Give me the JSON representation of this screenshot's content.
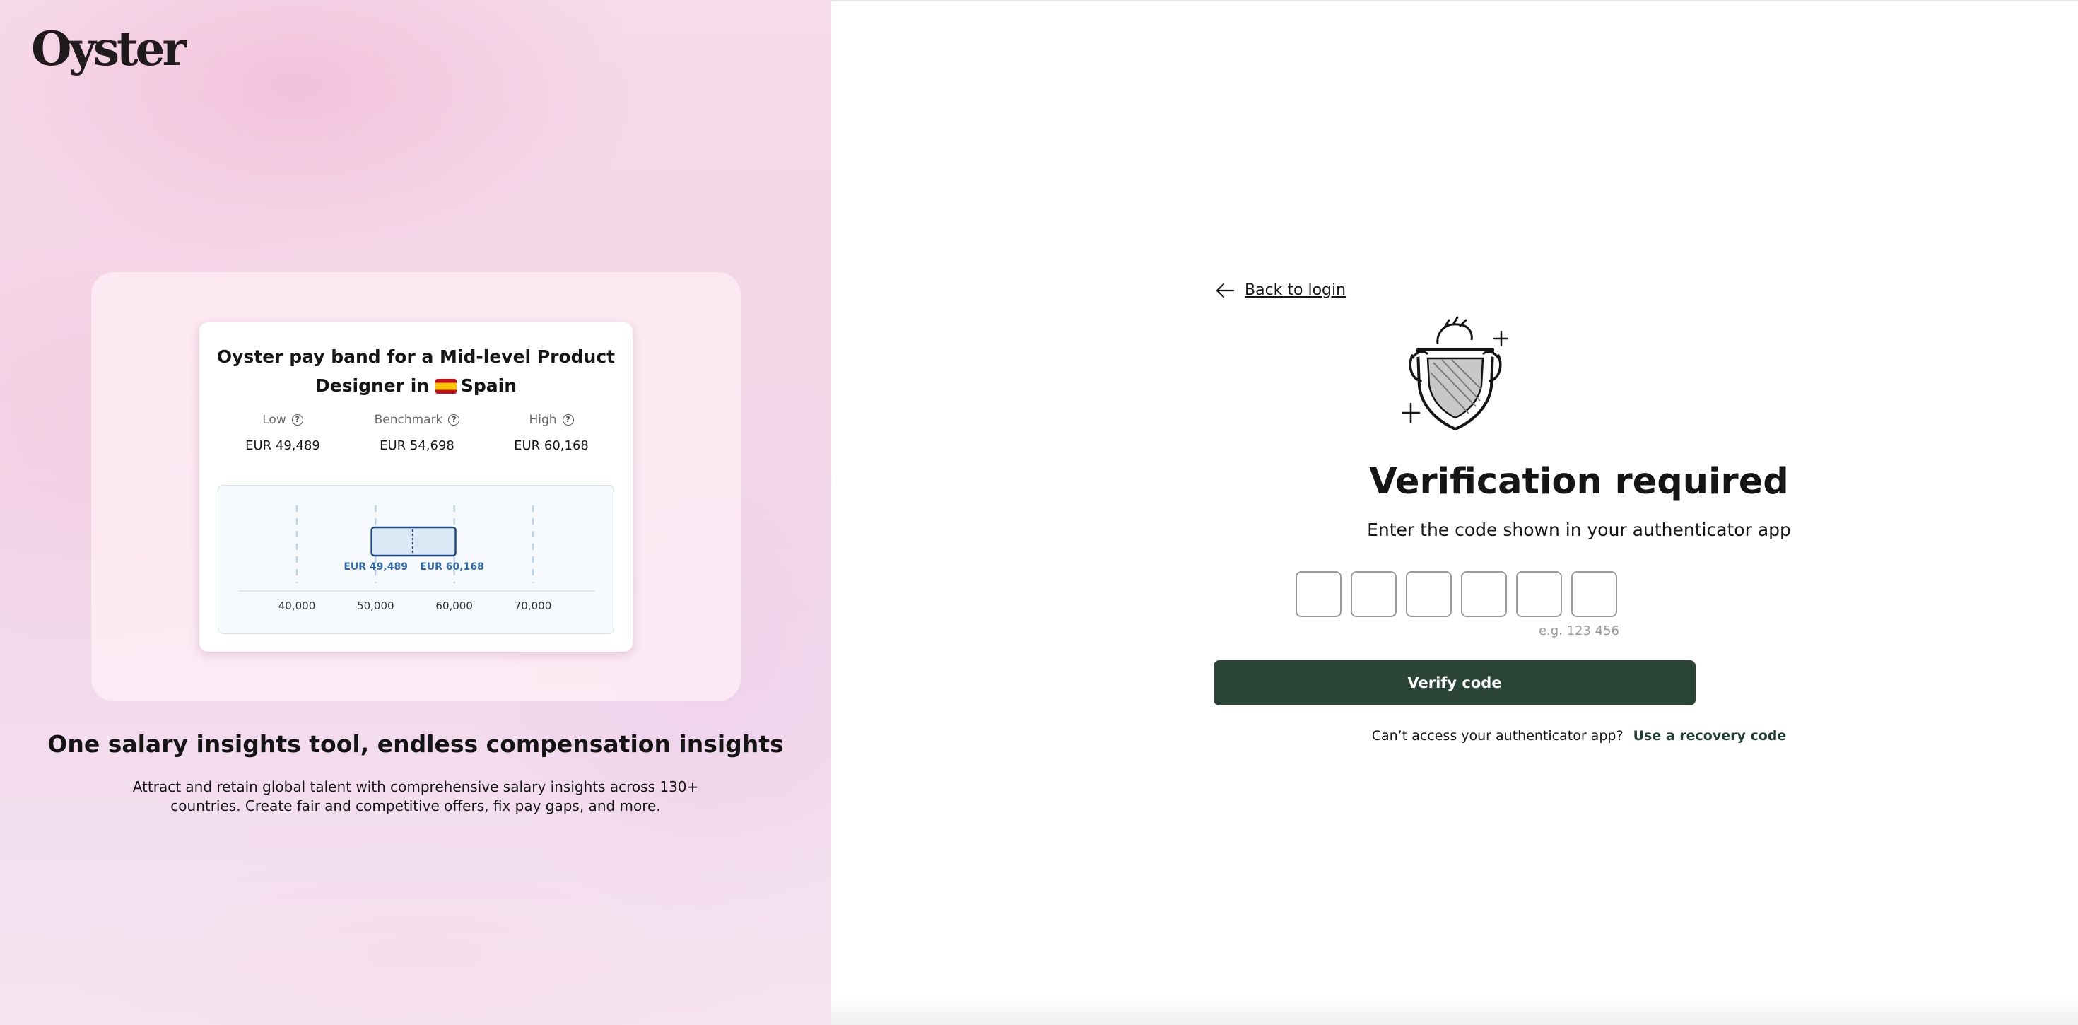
{
  "brand": {
    "logo_text": "Oyster"
  },
  "promo": {
    "card": {
      "title_line1": "Oyster pay band for a Mid-level Product",
      "title_line2_prefix": "Designer in",
      "title_country": "Spain",
      "flag_icon": "spain-flag-icon",
      "stats": [
        {
          "label": "Low",
          "value": "EUR 49,489"
        },
        {
          "label": "Benchmark",
          "value": "EUR 54,698"
        },
        {
          "label": "High",
          "value": "EUR 60,168"
        }
      ]
    },
    "heading": "One salary insights tool, endless compensation insights",
    "description": "Attract and retain global talent with comprehensive salary insights across 130+ countries. Create fair and competitive offers, fix pay gaps, and more."
  },
  "chart_data": {
    "type": "bar",
    "orientation": "horizontal-range",
    "x_ticks": [
      "40,000",
      "50,000",
      "60,000",
      "70,000"
    ],
    "xlim": [
      40000,
      70000
    ],
    "range": {
      "low": 49489,
      "benchmark": 54698,
      "high": 60168
    },
    "data_labels": [
      "EUR 49,489",
      "EUR 60,168"
    ],
    "colors": {
      "bar_fill": "#dbe8f6",
      "bar_stroke": "#1c4a86",
      "label": "#2f6aaf",
      "grid": "#b8d2e6"
    }
  },
  "auth": {
    "back_label": "Back to login",
    "title": "Verification required",
    "subtitle": "Enter the code shown in your authenticator app",
    "code_digits": [
      "",
      "",
      "",
      "",
      "",
      ""
    ],
    "hint": "e.g. 123 456",
    "verify_button": "Verify code",
    "recovery_prompt": "Can’t access your authenticator app?",
    "recovery_link": "Use a recovery code",
    "accent_color": "#2a4538"
  }
}
